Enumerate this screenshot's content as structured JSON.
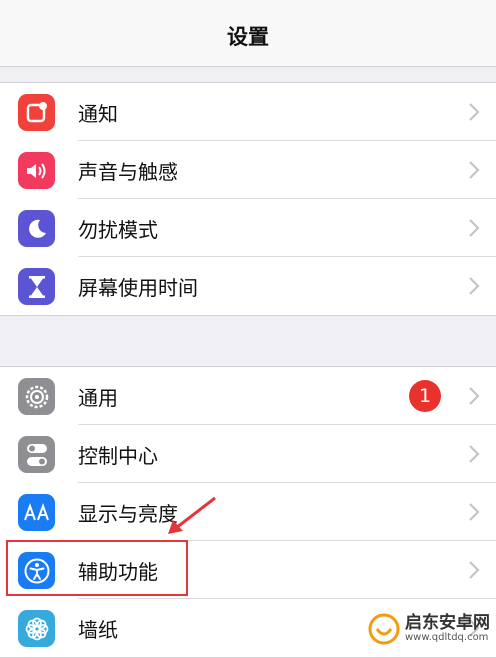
{
  "header": {
    "title": "设置"
  },
  "groups": [
    {
      "items": [
        {
          "label": "通知",
          "icon": "notifications-icon",
          "color": "#f0413a"
        },
        {
          "label": "声音与触感",
          "icon": "sound-icon",
          "color": "#f13a5e"
        },
        {
          "label": "勿扰模式",
          "icon": "moon-icon",
          "color": "#5b55d6"
        },
        {
          "label": "屏幕使用时间",
          "icon": "hourglass-icon",
          "color": "#5b55d6"
        }
      ]
    },
    {
      "items": [
        {
          "label": "通用",
          "icon": "gear-icon",
          "color": "#8e8e93",
          "badge": "1"
        },
        {
          "label": "控制中心",
          "icon": "toggles-icon",
          "color": "#8e8e93"
        },
        {
          "label": "显示与亮度",
          "icon": "text-size-icon",
          "color": "#1a7cf4"
        },
        {
          "label": "辅助功能",
          "icon": "accessibility-icon",
          "color": "#1a7cf4"
        },
        {
          "label": "墙纸",
          "icon": "flower-icon",
          "color": "#36aadc"
        }
      ]
    }
  ],
  "annotation": {
    "color": "#e2373a"
  },
  "watermark": {
    "name": "启东安卓网",
    "url": "www.qdltdq.com"
  }
}
